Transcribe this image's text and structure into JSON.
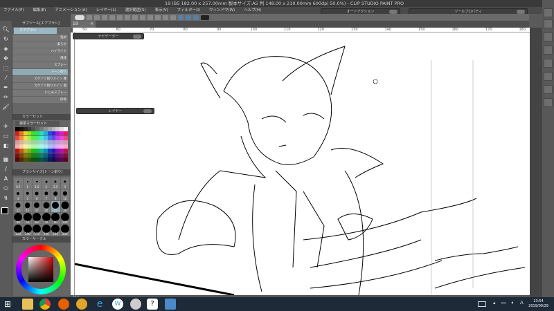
{
  "window": {
    "title": "19 (B5 182.00 x 257.00mm 製本サイズ:A5 判 148.00 x 210.00mm 600dpi 50.0%) - CLIP STUDIO PAINT PRO"
  },
  "menu": [
    "ファイル(F)",
    "編集(E)",
    "アニメーション(A)",
    "レイヤー(L)",
    "選択範囲(S)",
    "表示(V)",
    "フィルター(I)",
    "ウィンドウ(W)",
    "ヘルプ(H)"
  ],
  "floating_panels": {
    "auto_action": "オートアクション",
    "tool_property": "ツールプロパティ",
    "navigator": "ナビゲーター",
    "layer": "レイヤー"
  },
  "document_tab": "19",
  "ruler_ticks": [
    "50",
    "60",
    "70",
    "80",
    "90",
    "100",
    "110",
    "120",
    "130",
    "140",
    "150",
    "160",
    "170",
    "180"
  ],
  "subtool": {
    "header": "サブツール[エアブラシ]",
    "group_tab": "エアブラシ",
    "items": [
      "強め",
      "柔らか",
      "ハイライト",
      "飛沫",
      "スプレー",
      "トーン削り",
      "カケアミ削りメイン 薄",
      "カケアミ削りメイン 濃",
      "にじみスプレー",
      "砂埃"
    ],
    "selected": "トーン削り"
  },
  "color_set": {
    "header": "カラーセット",
    "selected_set": "標準カラーセット"
  },
  "brush_size": {
    "header": "ブラシサイズ[トーン削り]",
    "sizes": [
      "0.7",
      "1",
      "1.5",
      "2",
      "2.5",
      "3",
      "4",
      "5",
      "6",
      "7",
      "8",
      "10",
      "12",
      "15",
      "17",
      "20",
      "25",
      "30",
      "40",
      "50",
      "60",
      "70",
      "80",
      "100",
      "120",
      "150",
      "170",
      "200",
      "250",
      "300"
    ],
    "selected": "25"
  },
  "color_wheel": {
    "header": "カラーサークル",
    "main_color": "#000000",
    "sub_color": "#ffffff"
  },
  "status": {
    "zoom": "50.0"
  },
  "taskbar": {
    "apps": [
      "start",
      "file-explorer",
      "chrome",
      "firefox",
      "media-player",
      "internet-explorer",
      "wordpress",
      "app-spiral",
      "clip-studio",
      "photos"
    ],
    "time": "23:54",
    "date": "2019/09/29"
  },
  "colors": {
    "selected_subtool": "#8faab4",
    "panel": "#666666",
    "taskbar": "#1e2a38"
  }
}
